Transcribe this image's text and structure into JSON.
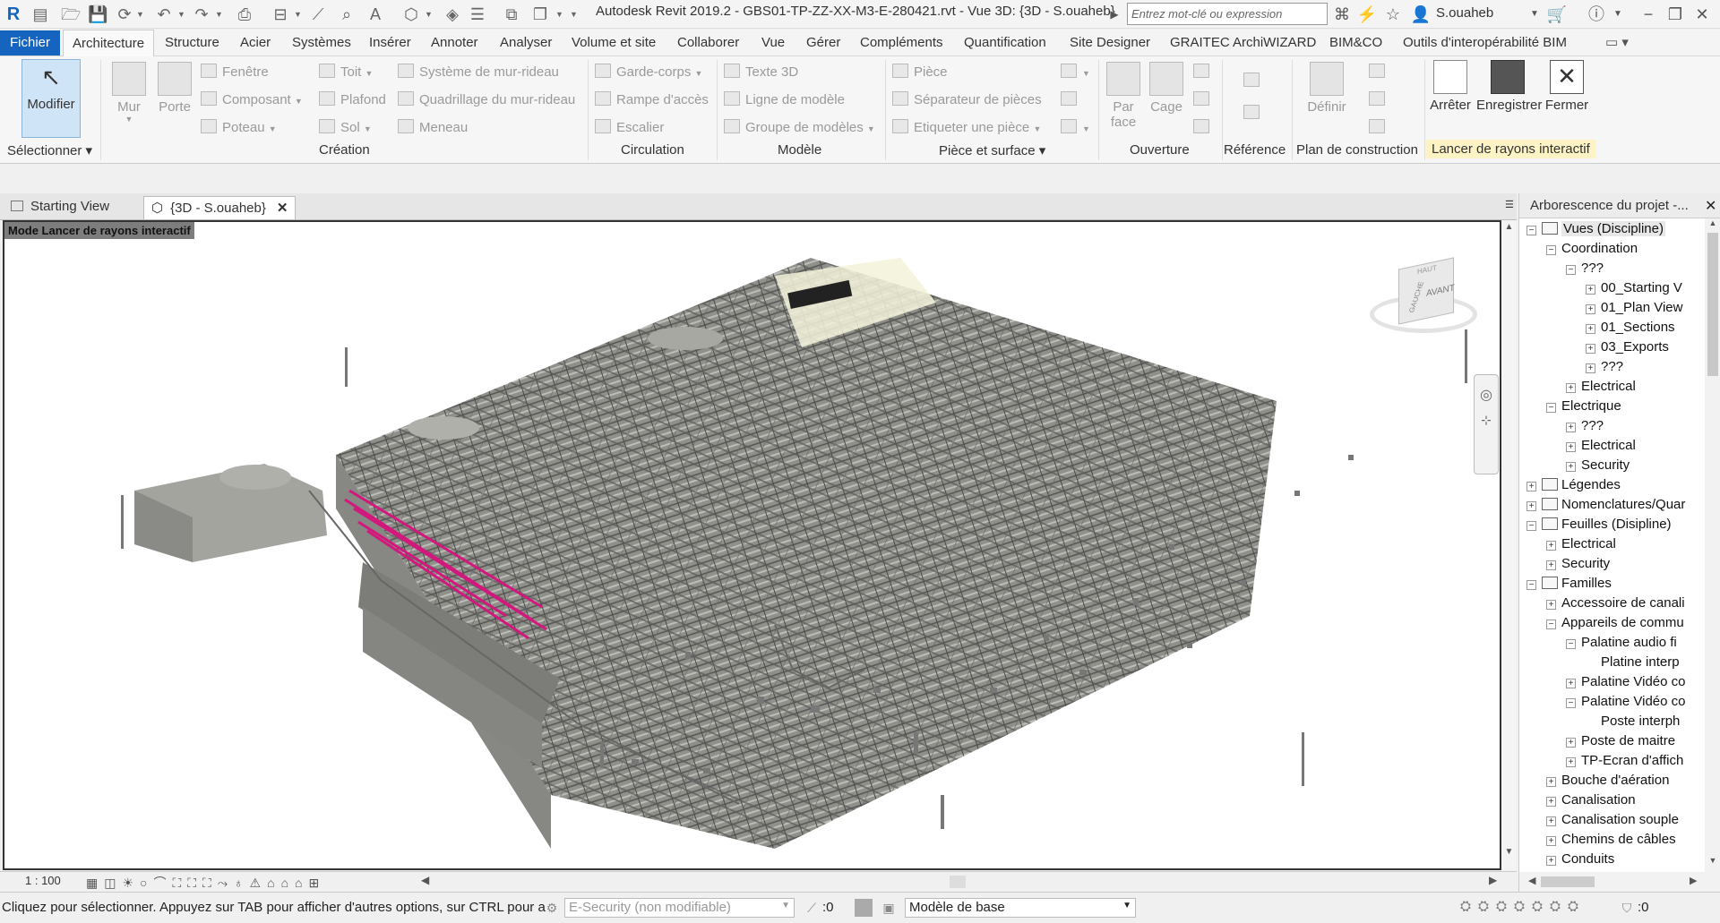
{
  "titlebar": {
    "title": "Autodesk Revit 2019.2 - GBS01-TP-ZZ-XX-M3-E-280421.rvt - Vue 3D: {3D - S.ouaheb}",
    "search_placeholder": "Entrez mot-clé ou expression",
    "username": "S.ouaheb"
  },
  "menu": {
    "items": [
      "Fichier",
      "Architecture",
      "Structure",
      "Acier",
      "Systèmes",
      "Insérer",
      "Annoter",
      "Analyser",
      "Volume et site",
      "Collaborer",
      "Vue",
      "Gérer",
      "Compléments",
      "Quantification",
      "Site Designer",
      "GRAITEC ArchiWIZARD",
      "BIM&CO",
      "Outils d'interopérabilité BIM"
    ]
  },
  "ribbon": {
    "modifier": "Modifier",
    "selectionner": "Sélectionner",
    "mur": "Mur",
    "porte": "Porte",
    "fenetre": "Fenêtre",
    "composant": "Composant",
    "poteau": "Poteau",
    "toit": "Toit",
    "plafond": "Plafond",
    "sol": "Sol",
    "systeme_mur_rideau": "Système de mur-rideau",
    "quadrillage": "Quadrillage du mur-rideau",
    "meneau": "Meneau",
    "garde_corps": "Garde-corps",
    "rampe": "Rampe d'accès",
    "escalier": "Escalier",
    "texte3d": "Texte 3D",
    "ligne_modele": "Ligne de modèle",
    "groupe_modeles": "Groupe de modèles",
    "piece": "Pièce",
    "separateur": "Séparateur de pièces",
    "etiqueter": "Etiqueter une pièce",
    "par_face_1": "Par",
    "par_face_2": "face",
    "cage": "Cage",
    "definir": "Définir",
    "arreter": "Arrêter",
    "enregistrer": "Enregistrer",
    "fermer": "Fermer",
    "groups": {
      "creation": "Création",
      "circulation": "Circulation",
      "modele": "Modèle",
      "piece_surface": "Pièce et surface",
      "ouverture": "Ouverture",
      "reference": "Référence",
      "plan_construction": "Plan de construction",
      "lancer_rayons": "Lancer de rayons interactif"
    }
  },
  "viewtabs": {
    "starting": "Starting View",
    "active": "{3D - S.ouaheb}"
  },
  "viewport": {
    "mode_label": "Mode Lancer de rayons interactif",
    "viewcube_top": "HAUT",
    "viewcube_left": "GAUCHE",
    "viewcube_front": "AVANT"
  },
  "viewctrl": {
    "scale": "1 : 100"
  },
  "browser": {
    "title": "Arborescence du projet -...",
    "nodes": [
      {
        "label": "Vues (Discipline)",
        "level": 0,
        "toggle": "−",
        "icon": true,
        "selected": true
      },
      {
        "label": "Coordination",
        "level": 1,
        "toggle": "−"
      },
      {
        "label": "???",
        "level": 2,
        "toggle": "−"
      },
      {
        "label": "00_Starting V",
        "level": 3,
        "toggle": "+"
      },
      {
        "label": "01_Plan View",
        "level": 3,
        "toggle": "+"
      },
      {
        "label": "01_Sections",
        "level": 3,
        "toggle": "+"
      },
      {
        "label": "03_Exports",
        "level": 3,
        "toggle": "+"
      },
      {
        "label": "???",
        "level": 3,
        "toggle": "+"
      },
      {
        "label": "Electrical",
        "level": 2,
        "toggle": "+"
      },
      {
        "label": "Electrique",
        "level": 1,
        "toggle": "−"
      },
      {
        "label": "???",
        "level": 2,
        "toggle": "+"
      },
      {
        "label": "Electrical",
        "level": 2,
        "toggle": "+"
      },
      {
        "label": "Security",
        "level": 2,
        "toggle": "+"
      },
      {
        "label": "Légendes",
        "level": 0,
        "toggle": "+",
        "icon": true
      },
      {
        "label": "Nomenclatures/Quar",
        "level": 0,
        "toggle": "+",
        "icon": true
      },
      {
        "label": "Feuilles (Disipline)",
        "level": 0,
        "toggle": "−",
        "icon": true
      },
      {
        "label": "Electrical",
        "level": 1,
        "toggle": "+"
      },
      {
        "label": "Security",
        "level": 1,
        "toggle": "+"
      },
      {
        "label": "Familles",
        "level": 0,
        "toggle": "−",
        "icon": true
      },
      {
        "label": "Accessoire de canali",
        "level": 1,
        "toggle": "+"
      },
      {
        "label": "Appareils de commu",
        "level": 1,
        "toggle": "−"
      },
      {
        "label": "Palatine audio fi",
        "level": 2,
        "toggle": "−"
      },
      {
        "label": "Platine interp",
        "level": 3,
        "toggle": ""
      },
      {
        "label": "Palatine Vidéo co",
        "level": 2,
        "toggle": "+"
      },
      {
        "label": "Palatine Vidéo co",
        "level": 2,
        "toggle": "−"
      },
      {
        "label": "Poste interph",
        "level": 3,
        "toggle": ""
      },
      {
        "label": "Poste de maitre",
        "level": 2,
        "toggle": "+"
      },
      {
        "label": "TP-Ecran d'affich",
        "level": 2,
        "toggle": "+"
      },
      {
        "label": "Bouche d'aération",
        "level": 1,
        "toggle": "+"
      },
      {
        "label": "Canalisation",
        "level": 1,
        "toggle": "+"
      },
      {
        "label": "Canalisation souple",
        "level": 1,
        "toggle": "+"
      },
      {
        "label": "Chemins de câbles",
        "level": 1,
        "toggle": "+"
      },
      {
        "label": "Conduits",
        "level": 1,
        "toggle": "+"
      }
    ]
  },
  "statusbar": {
    "text": "Cliquez pour sélectionner. Appuyez sur TAB pour afficher d'autres options, sur CTRL pour a",
    "workset": "E-Security (non modifiable)",
    "count": ":0",
    "design_option": "Modèle de base",
    "filter_count": ":0"
  }
}
